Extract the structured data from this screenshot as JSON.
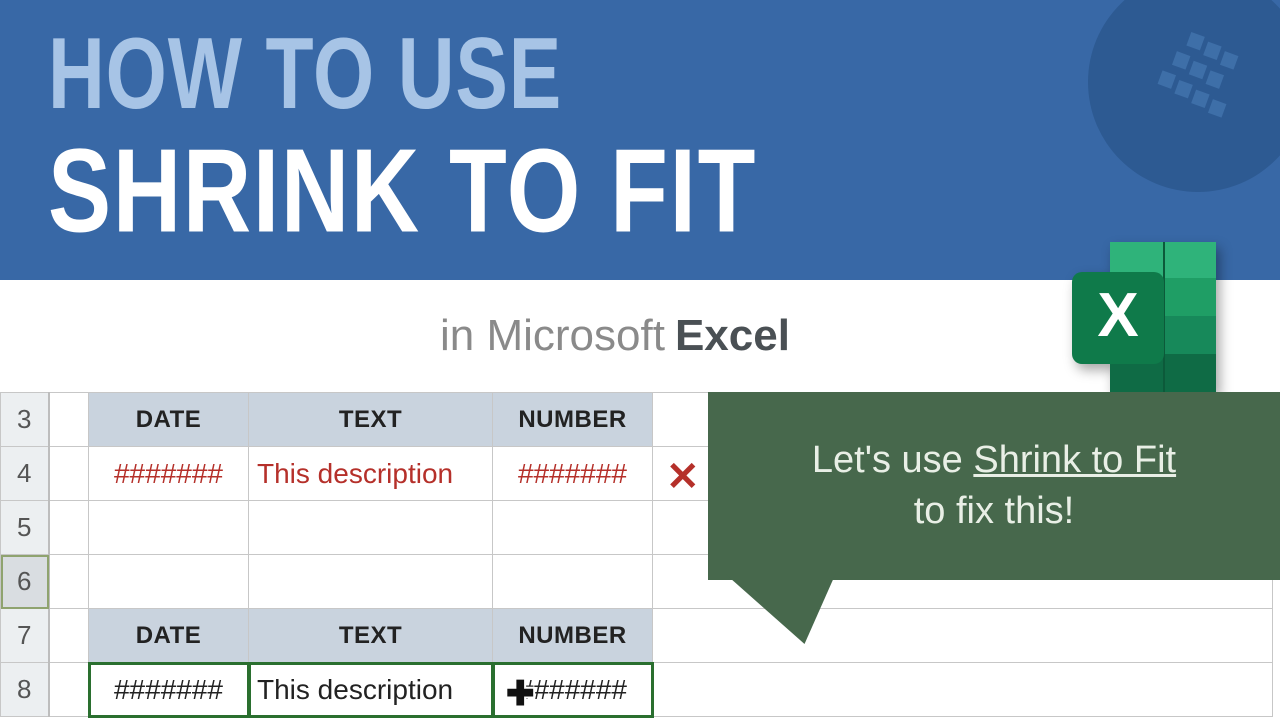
{
  "hero": {
    "line1": "HOW TO USE",
    "line2": "SHRINK TO FIT"
  },
  "sub": {
    "prefix": "in Microsoft",
    "strong": "Excel"
  },
  "sheet": {
    "row_labels": [
      "3",
      "4",
      "5",
      "6",
      "7",
      "8"
    ],
    "headers": {
      "date": "DATE",
      "text": "TEXT",
      "number": "NUMBER"
    },
    "row4": {
      "date": "#######",
      "text": "This description",
      "number": "#######"
    },
    "row8": {
      "date": "#######",
      "text": "This description",
      "number": "#######"
    }
  },
  "callout": {
    "pre": "Let's use ",
    "u": "Shrink to Fit",
    "post": " to fix this!"
  },
  "icons": {
    "x": "✕",
    "plus": "✚"
  }
}
